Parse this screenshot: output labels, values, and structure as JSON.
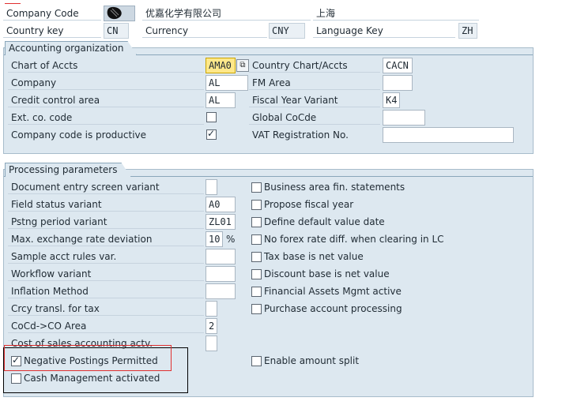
{
  "header": {
    "company_code_label": "Company Code",
    "company_name": "优嘉化学有限公司",
    "city": "上海",
    "country_key_label": "Country key",
    "country_key_value": "CN",
    "currency_label": "Currency",
    "currency_value": "CNY",
    "language_key_label": "Language Key",
    "language_key_value": "ZH"
  },
  "accounting_org": {
    "title": "Accounting organization",
    "chart_of_accts_label": "Chart of Accts",
    "chart_of_accts_value": "AMA0",
    "company_label": "Company",
    "company_value": "AL",
    "credit_control_label": "Credit control area",
    "credit_control_value": "AL",
    "ext_co_code_label": "Ext. co. code",
    "ext_co_code_checked": false,
    "company_productive_label": "Company code is productive",
    "company_productive_checked": true,
    "country_chart_label": "Country Chart/Accts",
    "country_chart_value": "CACN",
    "fm_area_label": "FM Area",
    "fm_area_value": "",
    "fiscal_year_variant_label": "Fiscal Year Variant",
    "fiscal_year_variant_value": "K4",
    "global_cocde_label": "Global CoCde",
    "global_cocde_value": "",
    "vat_reg_label": "VAT Registration No.",
    "vat_reg_value": ""
  },
  "processing": {
    "title": "Processing parameters",
    "doc_entry_label": "Document entry screen variant",
    "doc_entry_value": "",
    "field_status_label": "Field status variant",
    "field_status_value": "A0",
    "pstng_period_label": "Pstng period variant",
    "pstng_period_value": "ZL01",
    "max_exch_label": "Max. exchange rate deviation",
    "max_exch_value": "10",
    "max_exch_unit": "%",
    "sample_acct_label": "Sample acct rules var.",
    "sample_acct_value": "",
    "workflow_label": "Workflow variant",
    "workflow_value": "",
    "inflation_label": "Inflation Method",
    "inflation_value": "",
    "crcy_transl_label": "Crcy transl. for tax",
    "crcy_transl_value": "",
    "cocd_co_label": "CoCd->CO Area",
    "cocd_co_value": "2",
    "cost_of_sales_label": "Cost of sales accounting actv.",
    "cost_of_sales_value": "",
    "negative_postings_label": "Negative Postings Permitted",
    "negative_postings_checked": true,
    "cash_mgmt_label": "Cash Management activated",
    "cash_mgmt_checked": false,
    "right": [
      {
        "label": "Business area fin. statements",
        "checked": false
      },
      {
        "label": "Propose fiscal year",
        "checked": false
      },
      {
        "label": "Define default value date",
        "checked": false
      },
      {
        "label": "No forex rate diff. when clearing in LC",
        "checked": false
      },
      {
        "label": "Tax base is net value",
        "checked": false
      },
      {
        "label": "Discount base is net value",
        "checked": false
      },
      {
        "label": "Financial Assets Mgmt active",
        "checked": false
      },
      {
        "label": "Purchase account processing",
        "checked": false
      }
    ],
    "enable_amount_split_label": "Enable amount split",
    "enable_amount_split_checked": false
  },
  "colors": {
    "panel_bg": "#dde8f0",
    "highlight_red": "#e03030",
    "highlight_black": "#000000",
    "field_highlight": "#ffe88a"
  }
}
